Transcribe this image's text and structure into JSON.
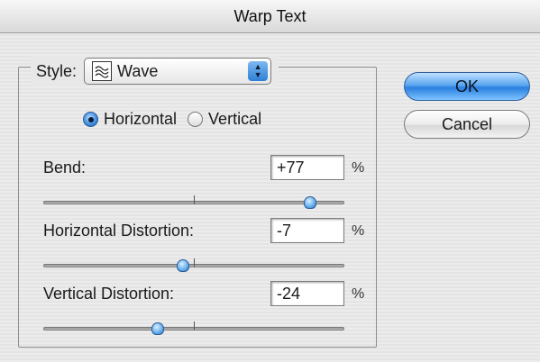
{
  "window": {
    "title": "Warp Text"
  },
  "style": {
    "label": "Style:",
    "value": "Wave",
    "icon": "wave-warp-icon"
  },
  "orientation": {
    "selected": "Horizontal",
    "options": [
      {
        "label": "Horizontal",
        "checked": true
      },
      {
        "label": "Vertical",
        "checked": false
      }
    ]
  },
  "fields": {
    "bend": {
      "label": "Bend:",
      "value": "+77",
      "unit": "%",
      "percent": 77
    },
    "horizontal_distortion": {
      "label": "Horizontal Distortion:",
      "value": "-7",
      "unit": "%",
      "percent": -7
    },
    "vertical_distortion": {
      "label": "Vertical Distortion:",
      "value": "-24",
      "unit": "%",
      "percent": -24
    }
  },
  "buttons": {
    "ok": "OK",
    "cancel": "Cancel"
  },
  "colors": {
    "accent": "#2a7fe0"
  }
}
